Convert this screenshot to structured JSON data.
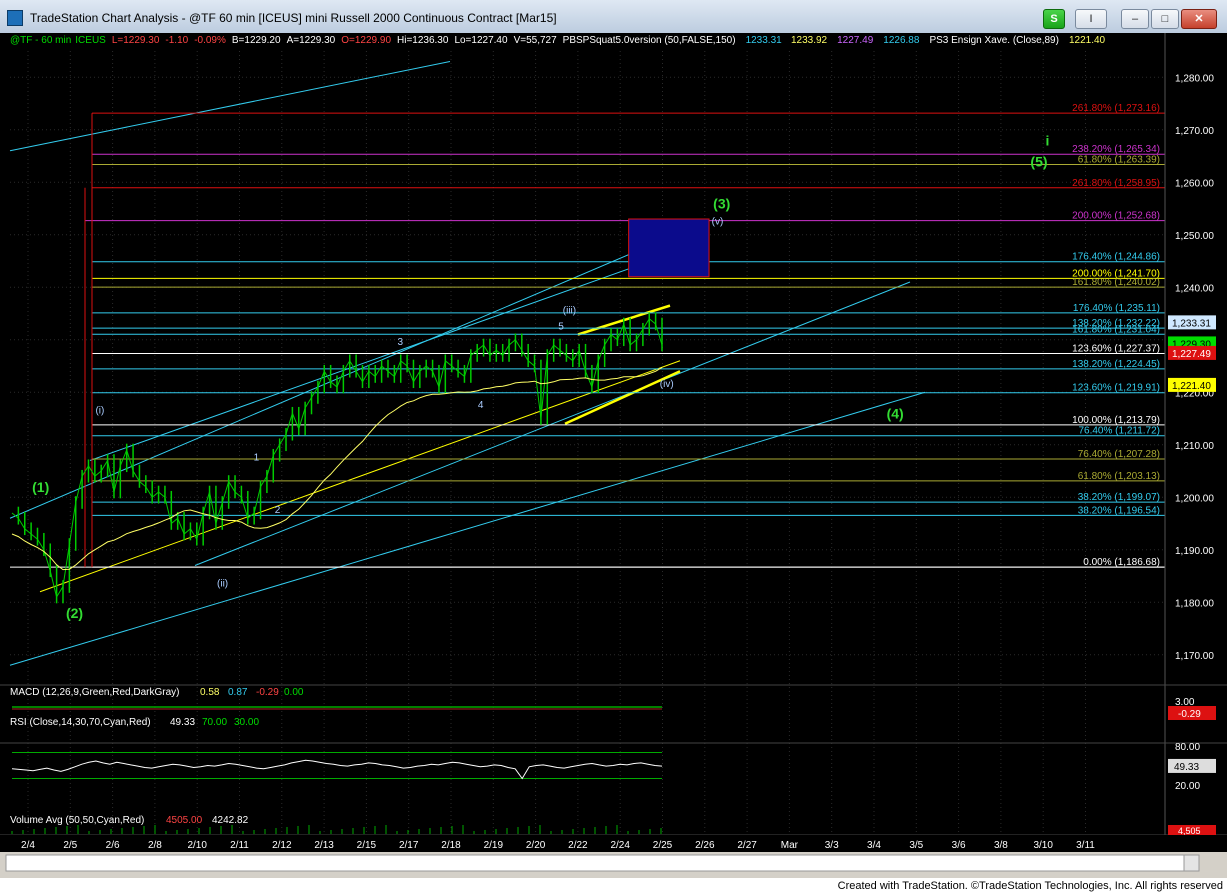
{
  "window": {
    "title": "TradeStation Chart Analysis - @TF 60 min [ICEUS] mini Russell 2000 Continuous Contract [Mar15]",
    "buttons": {
      "s": "S",
      "i": "I",
      "minimize": "–",
      "maximize": "□",
      "close": "✕"
    }
  },
  "status_line": {
    "symbol": "@TF - 60 min",
    "exchange": "ICEUS",
    "last": "L=1229.30",
    "change": "-1.10",
    "pct": "-0.09%",
    "bid": "B=1229.20",
    "ask": "A=1229.30",
    "open": "O=1229.90",
    "high": "Hi=1236.30",
    "low": "Lo=1227.40",
    "volume": "V=55,727",
    "indicator1": "PBSPSquat5.0version (50,FALSE,150)",
    "ind_values": [
      "1233.31",
      "1233.92",
      "1227.49",
      "1226.88"
    ],
    "indicator2": "PS3 Ensign Xave. (Close,89)",
    "ind2_value": "1221.40"
  },
  "colors": {
    "bg": "#000000",
    "price": "#00cc00",
    "cyan": "#33ccee",
    "yellow": "#ffff00",
    "red": "#dd1111",
    "magenta": "#cc33cc",
    "blue_box": "#0b0b8c",
    "grid": "#2a2a2a"
  },
  "chart_data": {
    "type": "line",
    "title": "@TF 60 min [ICEUS] mini Russell 2000 Continuous Contract [Mar15]",
    "xlabel": "",
    "ylabel": "",
    "ylim": [
      1165,
      1285
    ],
    "grid": true,
    "x_dates": [
      "2/4",
      "2/5",
      "2/6",
      "2/8",
      "2/10",
      "2/11",
      "2/12",
      "2/13",
      "2/15",
      "2/17",
      "2/18",
      "2/19",
      "2/20",
      "2/22",
      "2/24",
      "2/25",
      "2/26",
      "2/27",
      "Mar",
      "3/3",
      "3/4",
      "3/5",
      "3/6",
      "3/8",
      "3/10",
      "3/11"
    ],
    "y_ticks": [
      "1,280.00",
      "1,270.00",
      "1,260.00",
      "1,250.00",
      "1,240.00",
      "1,230.00",
      "1,220.00",
      "1,210.00",
      "1,200.00",
      "1,190.00",
      "1,180.00",
      "1,170.00"
    ],
    "series": [
      {
        "values": [
          1197,
          1196,
          1194,
          1193,
          1192,
          1190,
          1186,
          1181,
          1183,
          1191,
          1199,
          1204,
          1206,
          1204,
          1205,
          1207,
          1201,
          1206,
          1209,
          1205,
          1203,
          1202,
          1200,
          1201,
          1200,
          1195,
          1196,
          1193,
          1194,
          1192,
          1197,
          1201,
          1195,
          1199,
          1203,
          1201,
          1200,
          1196,
          1197,
          1202,
          1204,
          1208,
          1210,
          1212,
          1216,
          1213,
          1217,
          1219,
          1221,
          1224,
          1222,
          1221,
          1224,
          1226,
          1224,
          1222,
          1224,
          1223,
          1225,
          1224,
          1223,
          1226,
          1225,
          1222,
          1224,
          1225,
          1224,
          1221,
          1226,
          1225,
          1224,
          1223,
          1227,
          1228,
          1229,
          1227,
          1228,
          1227,
          1229,
          1230,
          1228,
          1226,
          1225,
          1215,
          1227,
          1229,
          1228,
          1227,
          1226,
          1228,
          1224,
          1221,
          1226,
          1229,
          1231,
          1230,
          1233,
          1229,
          1230,
          1232,
          1234,
          1233,
          1229
        ]
      }
    ],
    "fib_levels": [
      {
        "label": "261.80% (1,273.16)",
        "value": 1273.16,
        "color": "#dd1111"
      },
      {
        "label": "238.20% (1,265.34)",
        "value": 1265.34,
        "color": "#cc33cc"
      },
      {
        "label": "61.80% (1,263.39)",
        "value": 1263.39,
        "color": "#aaaa33"
      },
      {
        "label": "261.80% (1,258.95)",
        "value": 1258.95,
        "color": "#dd1111"
      },
      {
        "label": "200.00% (1,252.68)",
        "value": 1252.68,
        "color": "#cc33cc"
      },
      {
        "label": "176.40% (1,244.86)",
        "value": 1244.86,
        "color": "#33ccee"
      },
      {
        "label": "200.00% (1,241.70)",
        "value": 1241.7,
        "color": "#ffff00"
      },
      {
        "label": "161.80% (1,240.02)",
        "value": 1240.02,
        "color": "#aaaa33"
      },
      {
        "label": "176.40% (1,235.11)",
        "value": 1235.11,
        "color": "#33ccee"
      },
      {
        "label": "138.20% (1,232.22)",
        "value": 1232.22,
        "color": "#33ccee"
      },
      {
        "label": "161.80% (1,231.04)",
        "value": 1231.04,
        "color": "#33ccee"
      },
      {
        "label": "123.60% (1,227.37)",
        "value": 1227.37,
        "color": "#ffffff"
      },
      {
        "label": "138.20% (1,224.45)",
        "value": 1224.45,
        "color": "#33ccee"
      },
      {
        "label": "123.60% (1,219.91)",
        "value": 1219.91,
        "color": "#33ccee"
      },
      {
        "label": "100.00% (1,213.79)",
        "value": 1213.79,
        "color": "#ffffff"
      },
      {
        "label": "76.40% (1,211.72)",
        "value": 1211.72,
        "color": "#33ccee"
      },
      {
        "label": "76.40% (1,207.28)",
        "value": 1207.28,
        "color": "#aaaa33"
      },
      {
        "label": "61.80% (1,203.13)",
        "value": 1203.13,
        "color": "#aaaa33"
      },
      {
        "label": "38.20% (1,199.07)",
        "value": 1199.07,
        "color": "#33ccee"
      },
      {
        "label": "38.20% (1,196.54)",
        "value": 1196.54,
        "color": "#33ccee"
      },
      {
        "label": "0.00% (1,186.68)",
        "value": 1186.68,
        "color": "#ffffff"
      }
    ],
    "price_tags": [
      {
        "label": "1,233.31",
        "value": 1233.31,
        "bg": "#cfe8ff",
        "fg": "#000000"
      },
      {
        "label": "1,229.30",
        "value": 1229.3,
        "bg": "#00dd00",
        "fg": "#000000"
      },
      {
        "label": "1,227.49",
        "value": 1227.49,
        "bg": "#dd1111",
        "fg": "#ffffff"
      },
      {
        "label": "1,221.40",
        "value": 1221.4,
        "bg": "#ffff00",
        "fg": "#000000"
      }
    ],
    "wave_labels": [
      {
        "text": "(1)",
        "color": "#33dd33",
        "date_index": 0.3,
        "value": 1201
      },
      {
        "text": "(2)",
        "color": "#33dd33",
        "date_index": 1.1,
        "value": 1177
      },
      {
        "text": "(i)",
        "color": "#aaccff",
        "date_index": 1.7,
        "value": 1216
      },
      {
        "text": "(ii)",
        "color": "#aaccff",
        "date_index": 4.6,
        "value": 1183
      },
      {
        "text": "1",
        "color": "#aaccff",
        "date_index": 5.4,
        "value": 1207
      },
      {
        "text": "2",
        "color": "#aaccff",
        "date_index": 5.9,
        "value": 1197
      },
      {
        "text": "3",
        "color": "#aaccff",
        "date_index": 8.8,
        "value": 1229
      },
      {
        "text": "4",
        "color": "#aaccff",
        "date_index": 10.7,
        "value": 1217
      },
      {
        "text": "5",
        "color": "#aaccff",
        "date_index": 12.6,
        "value": 1232
      },
      {
        "text": "(iii)",
        "color": "#aaccff",
        "date_index": 12.8,
        "value": 1235
      },
      {
        "text": "(iv)",
        "color": "#aaccff",
        "date_index": 15.1,
        "value": 1221
      },
      {
        "text": "(v)",
        "color": "#aaccff",
        "date_index": 16.3,
        "value": 1252
      },
      {
        "text": "(3)",
        "color": "#33dd33",
        "date_index": 16.4,
        "value": 1255
      },
      {
        "text": "(4)",
        "color": "#33dd33",
        "date_index": 20.5,
        "value": 1215
      },
      {
        "text": "(5)",
        "color": "#33dd33",
        "date_index": 23.9,
        "value": 1263
      },
      {
        "text": "i",
        "color": "#33dd33",
        "date_index": 24.1,
        "value": 1267
      }
    ],
    "target_box": {
      "x_from": 14.2,
      "x_to": 16.1,
      "y_from": 1242,
      "y_to": 1253
    },
    "macd": {
      "label": "MACD (12,26,9,Green,Red,DarkGray)",
      "values": [
        "0.58",
        "0.87",
        "-0.29",
        "0.00"
      ],
      "ticks": [
        "3.00"
      ],
      "tag": "-0.29"
    },
    "rsi": {
      "label": "RSI (Close,14,30,70,Cyan,Red)",
      "values": [
        "49.33",
        "70.00",
        "30.00"
      ],
      "ticks": [
        "80.00",
        "20.00"
      ],
      "tag": "49.33",
      "series": [
        45,
        44,
        43,
        42,
        44,
        46,
        43,
        41,
        44,
        48,
        52,
        55,
        57,
        54,
        52,
        55,
        53,
        51,
        49,
        47,
        46,
        48,
        50,
        52,
        51,
        49,
        47,
        48,
        50,
        49,
        51,
        53,
        52,
        50,
        48,
        46,
        45,
        47,
        49,
        51,
        54,
        56,
        58,
        57,
        55,
        53,
        52,
        50,
        49,
        51,
        52,
        54,
        53,
        51,
        50,
        48,
        46,
        47,
        49,
        50,
        52,
        51,
        53,
        55,
        54,
        52,
        50,
        48,
        49,
        51,
        50,
        47,
        45,
        30,
        48,
        50,
        51,
        49,
        47,
        46,
        48,
        50,
        52,
        53,
        51,
        49,
        50,
        52,
        51,
        53,
        54,
        52,
        50,
        49
      ]
    },
    "volume": {
      "label": "Volume Avg (50,50,Cyan,Red)",
      "values": [
        "4505.00",
        "4242.82"
      ],
      "tag": "4,505"
    }
  },
  "footer": {
    "credit": "Created with TradeStation. ©TradeStation Technologies, Inc. All rights reserved"
  }
}
